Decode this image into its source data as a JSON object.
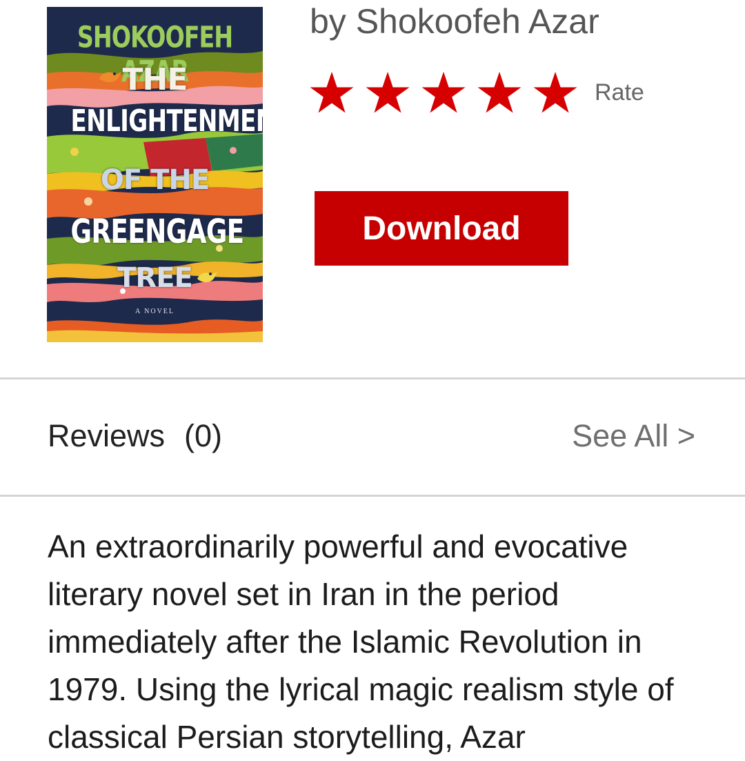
{
  "book": {
    "cover": {
      "author_text": "SHOKOOFEH AZAR",
      "title_lines": [
        "THE",
        "ENLIGHTENMENT",
        "OF THE",
        "GREENGAGE",
        "TREE"
      ],
      "subtitle": "A NOVEL",
      "background_color": "#1e2a4c"
    },
    "byline": "by Shokoofeh Azar"
  },
  "rating": {
    "stars_filled": 5,
    "stars_total": 5,
    "star_color": "#d60000",
    "label": "Rate"
  },
  "actions": {
    "download_label": "Download",
    "download_color": "#c60000"
  },
  "reviews": {
    "label": "Reviews",
    "count": "(0)",
    "see_all": "See All >"
  },
  "description": {
    "text": "An extraordinarily powerful and evocative literary novel set in Iran in the period immediately after the Islamic Revolution in 1979. Using the lyrical magic realism style of classical Persian storytelling, Azar"
  },
  "icons": {
    "star": "star-icon",
    "bird": "bird-icon"
  }
}
